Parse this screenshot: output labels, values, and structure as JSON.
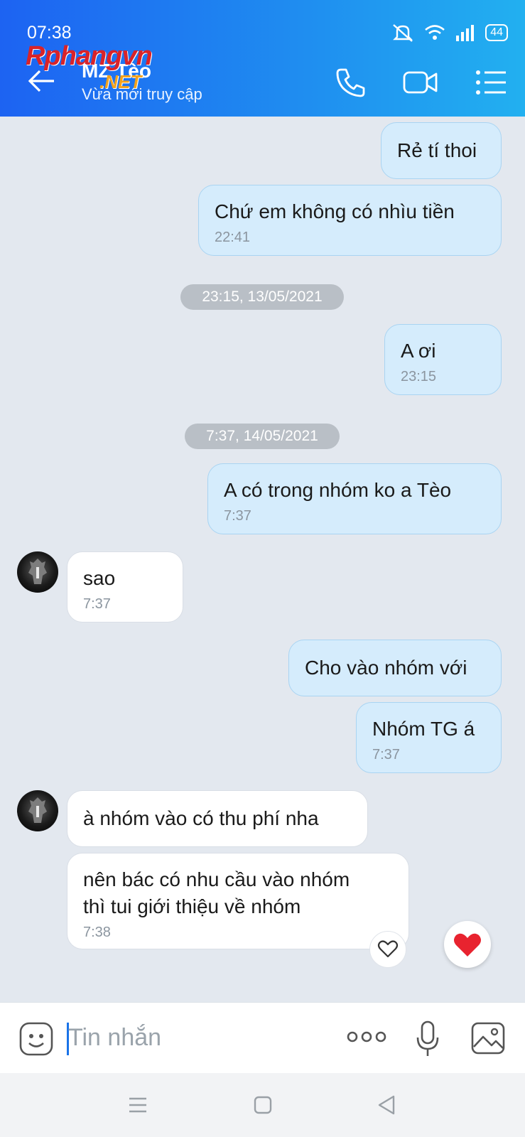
{
  "status_bar": {
    "time": "07:38",
    "battery": "44"
  },
  "header": {
    "contact_name": "MZ Tèo",
    "contact_status": "Vừa mới truy cập",
    "watermark": "Rphangvn",
    "watermark_suffix": ".NET",
    "icons": [
      "back-arrow-icon",
      "phone-icon",
      "video-call-icon",
      "menu-icon"
    ]
  },
  "messages": [
    {
      "side": "out",
      "text": "Rẻ tí thoi",
      "time": ""
    },
    {
      "side": "out",
      "text": "Chứ em không có nhìu tiền",
      "time": "22:41"
    },
    {
      "type": "date",
      "text": "23:15, 13/05/2021"
    },
    {
      "side": "out",
      "text": "A ơi",
      "time": "23:15"
    },
    {
      "type": "date",
      "text": "7:37, 14/05/2021"
    },
    {
      "side": "out",
      "text": "A có trong nhóm ko a Tèo",
      "time": "7:37"
    },
    {
      "side": "in",
      "text": "sao",
      "time": "7:37"
    },
    {
      "side": "out",
      "text": "Cho vào nhóm với",
      "time": ""
    },
    {
      "side": "out",
      "text": "Nhóm TG á",
      "time": "7:37"
    },
    {
      "side": "in",
      "text": "à nhóm vào có thu phí nha",
      "time": ""
    },
    {
      "side": "in",
      "text_lines": [
        "nên bác có nhu cầu vào nhóm",
        "thì tui giới thiệu về nhóm"
      ],
      "time": "7:38"
    }
  ],
  "composer": {
    "placeholder": "Tin nhắn"
  },
  "colors": {
    "header_start": "#1d63f2",
    "header_end": "#22b0f0",
    "outgoing": "#d5ecfc",
    "incoming": "#ffffff",
    "heart": "#e8232f"
  }
}
